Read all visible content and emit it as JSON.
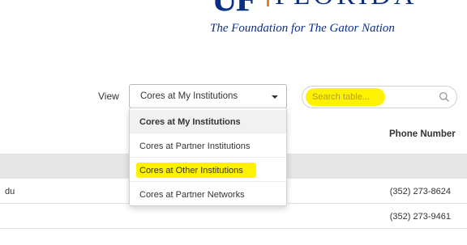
{
  "header": {
    "logo_mark": "UF",
    "logo_wordmark": "FLORIDA",
    "tagline": "The Foundation for The Gator Nation"
  },
  "controls": {
    "view_label": "View",
    "view_select": {
      "selected": "Cores at My Institutions",
      "options": [
        "Cores at My Institutions",
        "Cores at Partner Institutions",
        "Cores at Other Institutions",
        "Cores at Partner Networks"
      ],
      "highlighted_option": "Cores at Other Institutions"
    },
    "search": {
      "placeholder": "Search table..."
    }
  },
  "table": {
    "columns": [
      "Phone Number"
    ],
    "rows": [
      {
        "c1": "du",
        "phone": "(352) 273-8624"
      },
      {
        "c1": "",
        "phone": "(352) 273-9461"
      },
      {
        "c1": "",
        "phone": ""
      }
    ]
  },
  "colors": {
    "brand_blue": "#0a2f87",
    "brand_orange": "#f07a22",
    "highlight": "#fff200"
  },
  "icons": {
    "search": "search-icon",
    "caret": "caret-down-icon"
  }
}
